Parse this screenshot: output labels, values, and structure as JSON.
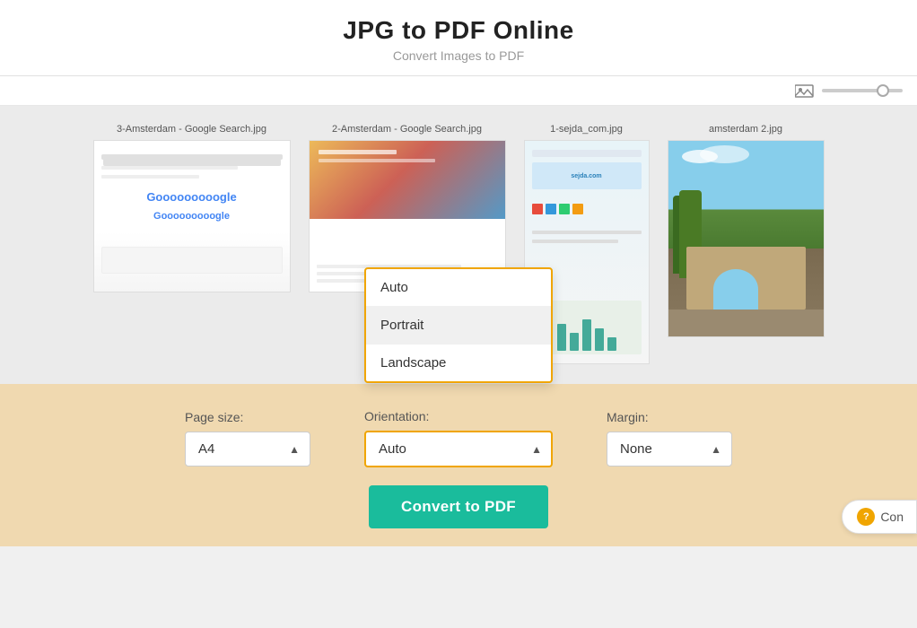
{
  "header": {
    "title": "JPG to PDF Online",
    "subtitle": "Convert Images to PDF"
  },
  "images": [
    {
      "label": "3-Amsterdam - Google Search.jpg",
      "type": "google1"
    },
    {
      "label": "2-Amsterdam - Google Search.jpg",
      "type": "google2"
    },
    {
      "label": "1-sejda_com.jpg",
      "type": "sejda"
    },
    {
      "label": "amsterdam 2.jpg",
      "type": "amsterdam"
    }
  ],
  "controls": {
    "page_size_label": "Page size:",
    "page_size_value": "A4",
    "orientation_label": "Orientation:",
    "orientation_value": "Auto",
    "margin_label": "Margin:",
    "margin_value": "None"
  },
  "orientation_dropdown": {
    "options": [
      {
        "label": "Auto",
        "highlighted": false
      },
      {
        "label": "Portrait",
        "highlighted": true
      },
      {
        "label": "Landscape",
        "highlighted": false
      }
    ],
    "selected": "Auto"
  },
  "convert_button": {
    "label": "Convert to PDF"
  },
  "con_button": {
    "label": "Con"
  },
  "zoom": {
    "value": 80
  }
}
